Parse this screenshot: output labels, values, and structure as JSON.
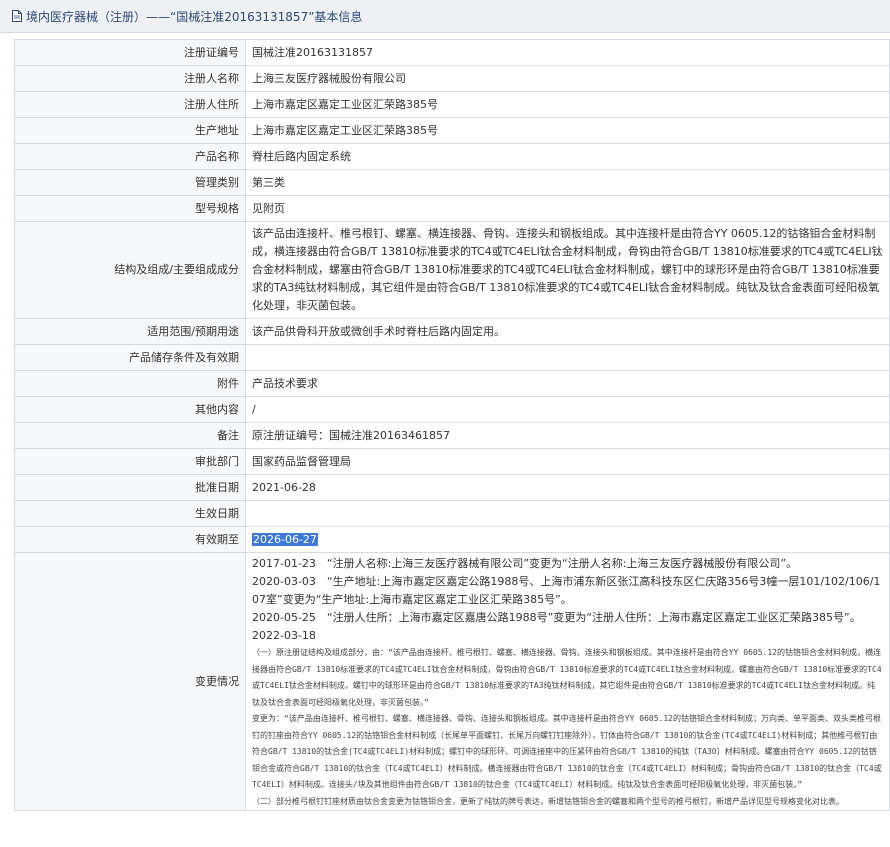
{
  "header": {
    "title": "境内医疗器械（注册）——“国械注准20163131857”基本信息"
  },
  "rows": [
    {
      "label": "注册证编号",
      "value": "国械注准20163131857"
    },
    {
      "label": "注册人名称",
      "value": "上海三友医疗器械股份有限公司"
    },
    {
      "label": "注册人住所",
      "value": "上海市嘉定区嘉定工业区汇荣路385号"
    },
    {
      "label": "生产地址",
      "value": "上海市嘉定区嘉定工业区汇荣路385号"
    },
    {
      "label": "产品名称",
      "value": "脊柱后路内固定系统"
    },
    {
      "label": "管理类别",
      "value": "第三类"
    },
    {
      "label": "型号规格",
      "value": "见附页"
    },
    {
      "label": "结构及组成/主要组成成分",
      "value": "该产品由连接杆、椎弓根钉、螺塞、横连接器、骨钩、连接头和钢板组成。其中连接杆是由符合YY 0605.12的钴铬钼合金材料制成，横连接器由符合GB/T 13810标准要求的TC4或TC4ELI钛合金材料制成，骨钩由符合GB/T 13810标准要求的TC4或TC4ELI钛合金材料制成，螺塞由符合GB/T 13810标准要求的TC4或TC4ELI钛合金材料制成，螺钉中的球形环是由符合GB/T 13810标准要求的TA3纯钛材料制成，其它组件是由符合GB/T 13810标准要求的TC4或TC4ELI钛合金材料制成。纯钛及钛合金表面可经阳极氧化处理，非灭菌包装。"
    },
    {
      "label": "适用范围/预期用途",
      "value": "该产品供骨科开放或微创手术时脊柱后路内固定用。"
    },
    {
      "label": "产品储存条件及有效期",
      "value": ""
    },
    {
      "label": "附件",
      "value": "产品技术要求"
    },
    {
      "label": "其他内容",
      "value": "/"
    },
    {
      "label": "备注",
      "value": "原注册证编号：国械注准20163461857"
    },
    {
      "label": "审批部门",
      "value": "国家药品监督管理局"
    },
    {
      "label": "批准日期",
      "value": "2021-06-28"
    },
    {
      "label": "生效日期",
      "value": ""
    },
    {
      "label": "有效期至",
      "value": "2026-06-27"
    }
  ],
  "changes": {
    "label": "变更情况",
    "lines": [
      "2017-01-23　“注册人名称:上海三友医疗器械有限公司”变更为“注册人名称:上海三友医疗器械股份有限公司”。",
      "2020-03-03　“生产地址:上海市嘉定区嘉定公路1988号、上海市浦东新区张江高科技东区仁庆路356号3幢一层101/102/106/107室”变更为“生产地址:上海市嘉定区嘉定工业区汇荣路385号”。",
      "2020-05-25　“注册人住所：上海市嘉定区嘉唐公路1988号”变更为“注册人住所：上海市嘉定区嘉定工业区汇荣路385号”。",
      "2022-03-18"
    ],
    "detail": [
      "（一）原注册证结构及组成部分，由：“该产品由连接杆、椎弓根钉、螺塞、横连接器、骨钩、连接头和钢板组成。其中连接杆是由符合YY 0605.12的钴铬钼合金材料制成，横连接器由符合GB/T 13810标准要求的TC4或TC4ELI钛合金材料制成，骨钩由符合GB/T 13810标准要求的TC4或TC4ELI钛合金材料制成，螺塞由符合GB/T 13810标准要求的TC4或TC4ELI钛合金材料制成，螺钉中的球形环是由符合GB/T 13810标准要求的TA3纯钛材料制成，其它组件是由符合GB/T 13810标准要求的TC4或TC4ELI钛合金材料制成。纯钛及钛合金表面可经阳极氧化处理，非灭菌包装。”",
      "变更为：“该产品由连接杆、椎弓根钉、螺塞、横连接器、骨钩、连接头和钢板组成。其中连接杆是由符合YY 0605.12的钴铬钼合金材料制成；万向类、单平面类、双头类椎弓根钉的钉座由符合YY 0605.12的钴铬钼合金材料制成（长尾单平面螺钉、长尾万向螺钉钉座除外），钉体由符合GB/T 13810的钛合金(TC4或TC4ELI)材料制成；其他椎弓根钉由符合GB/T 13810的钛合金(TC4或TC4ELI)材料制成；螺钉中的球形环、可调连接座中的压紧环由符合GB/T 13810的纯钛（TA3O）材料制成。螺塞由符合YY 0605.12的钴铬钼合金或符合GB/T 13810的钛合金（TC4或TC4ELI）材料制成。横连接器由符合GB/T 13810的钛合金（TC4或TC4ELI）材料制成；骨钩由符合GB/T 13810的钛合金（TC4或TC4ELI）材料制成。连接头/块及其他组件由符合GB/T 13810的钛合金（TC4或TC4ELI）材料制成。纯钛及钛合金表面可经阳极氧化处理，非灭菌包装。”",
      "（二）部分椎弓根钉钉座材质由钛合金变更为钴铬钼合金，更新了纯钛的牌号表达，新增钴铬钼合金的螺塞和两个型号的椎弓根钉，新增产品详见型号规格变化对比表。"
    ]
  },
  "colors": {
    "label_bg": "#f6f7f9",
    "border": "#d6dbe3",
    "title_color": "#2b4a7a",
    "highlight": "#3f79d6"
  }
}
